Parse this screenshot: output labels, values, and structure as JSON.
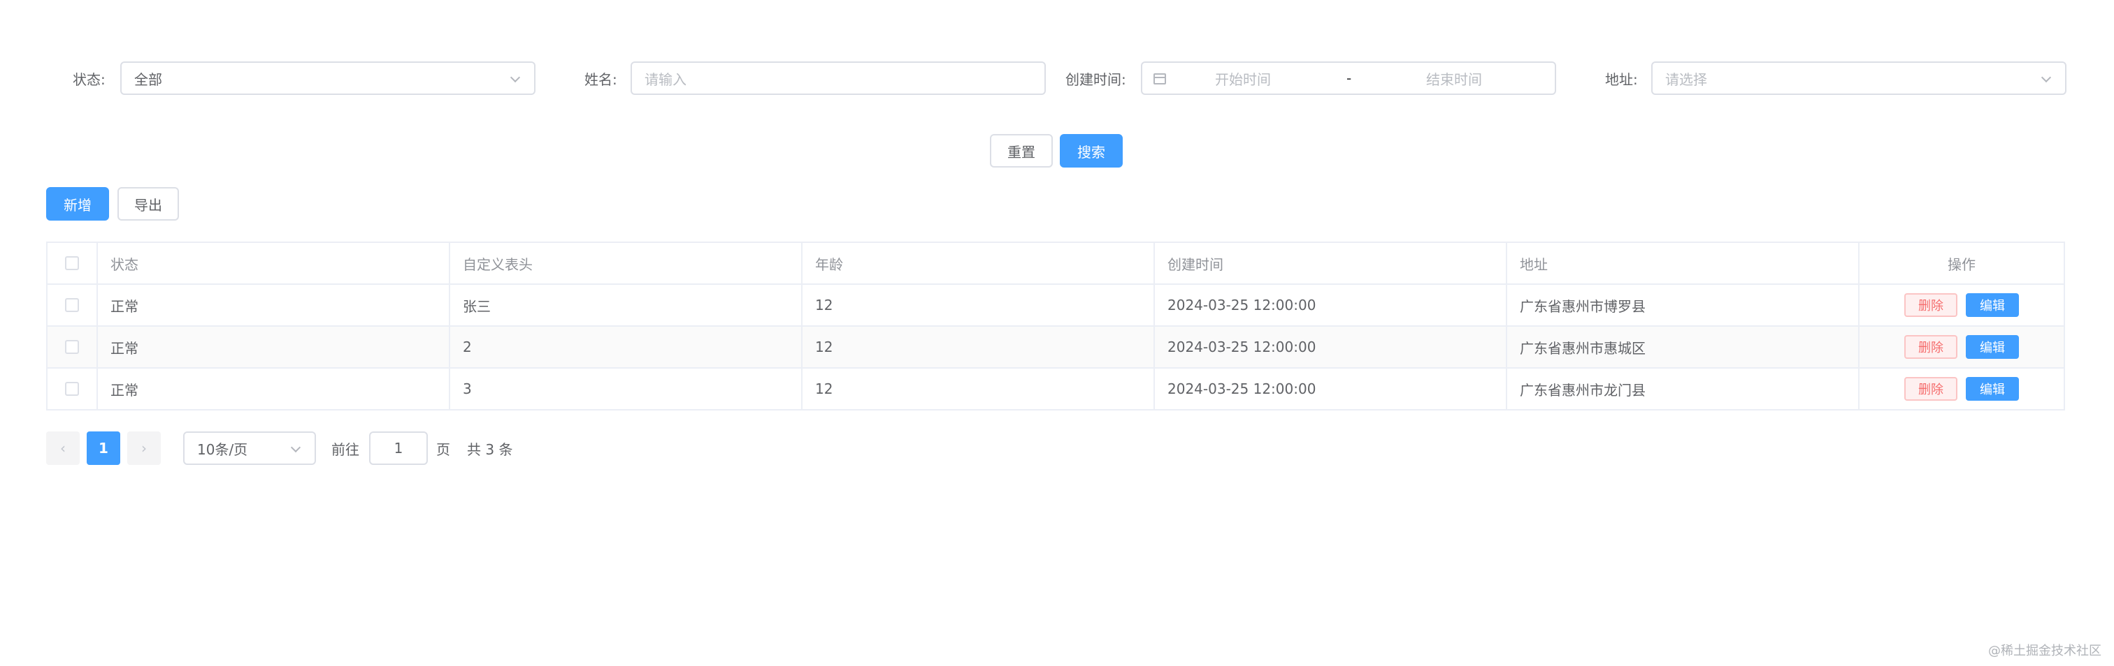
{
  "filters": {
    "status_label": "状态:",
    "status_value": "全部",
    "name_label": "姓名:",
    "name_placeholder": "请输入",
    "created_label": "创建时间:",
    "start_placeholder": "开始时间",
    "range_separator": "-",
    "end_placeholder": "结束时间",
    "address_label": "地址:",
    "address_placeholder": "请选择"
  },
  "actions": {
    "reset": "重置",
    "search": "搜索",
    "add": "新增",
    "export": "导出"
  },
  "table": {
    "headers": [
      "状态",
      "自定义表头",
      "年龄",
      "创建时间",
      "地址",
      "操作"
    ],
    "rows": [
      {
        "status": "正常",
        "custom": "张三",
        "age": "12",
        "created": "2024-03-25 12:00:00",
        "address": "广东省惠州市博罗县"
      },
      {
        "status": "正常",
        "custom": "2",
        "age": "12",
        "created": "2024-03-25 12:00:00",
        "address": "广东省惠州市惠城区"
      },
      {
        "status": "正常",
        "custom": "3",
        "age": "12",
        "created": "2024-03-25 12:00:00",
        "address": "广东省惠州市龙门县"
      }
    ],
    "delete_label": "删除",
    "edit_label": "编辑"
  },
  "pagination": {
    "prev": "‹",
    "current_page": "1",
    "next": "›",
    "page_size": "10条/页",
    "goto_label": "前往",
    "goto_value": "1",
    "page_suffix": "页",
    "total": "共 3 条"
  },
  "watermark": "@稀土掘金技术社区",
  "colors": {
    "primary": "#409eff",
    "danger": "#f56c6c",
    "border": "#dcdfe6"
  }
}
